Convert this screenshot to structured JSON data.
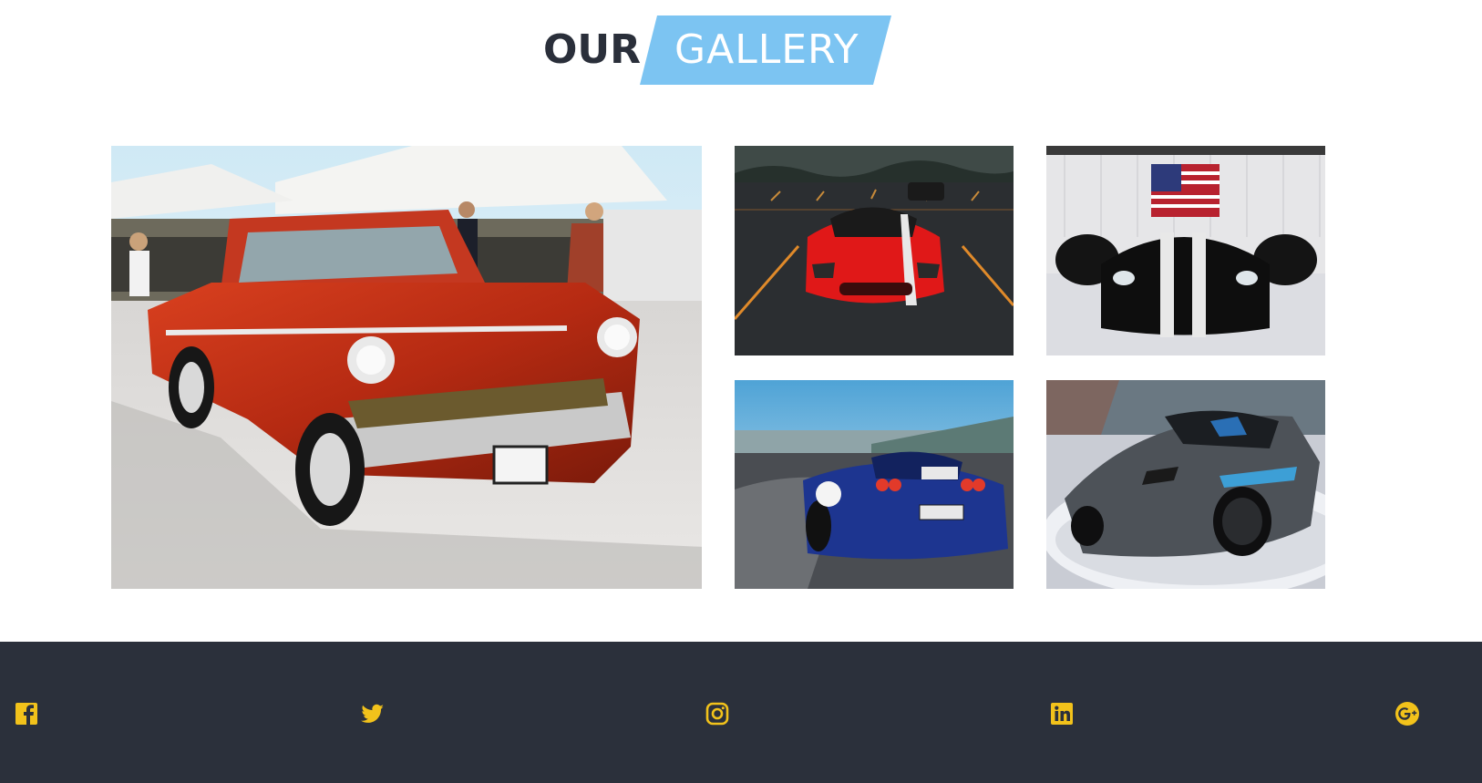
{
  "section": {
    "title_part1": "OUR",
    "title_part2": "GALLERY"
  },
  "gallery": [
    {
      "name": "classic-red-chevrolet"
    },
    {
      "name": "red-viper-parking-lot"
    },
    {
      "name": "black-viper-hangar"
    },
    {
      "name": "blue-ferrari-track"
    },
    {
      "name": "gray-corvette-showroom"
    }
  ],
  "colors": {
    "title_dark": "#2a2f3a",
    "title_accent_bg": "#7cc4f2",
    "footer_bg": "#2b303b",
    "social_icon": "#f2c21b"
  },
  "social": [
    {
      "icon": "facebook-icon"
    },
    {
      "icon": "twitter-icon"
    },
    {
      "icon": "instagram-icon"
    },
    {
      "icon": "linkedin-icon"
    },
    {
      "icon": "google-plus-icon"
    }
  ]
}
